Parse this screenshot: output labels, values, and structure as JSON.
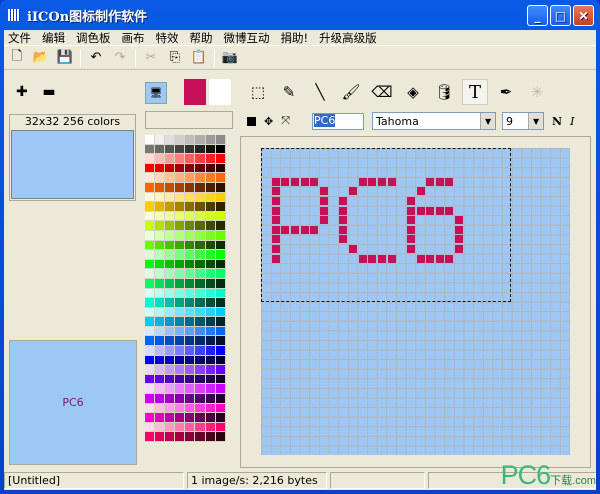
{
  "window": {
    "title": "iICOn图标制作软件"
  },
  "menu": [
    "文件",
    "编辑",
    "调色板",
    "画布",
    "特效",
    "帮助",
    "微博互动",
    "捐助!",
    "升级高级版"
  ],
  "toolbar": [
    {
      "icon": "new-file-icon",
      "glyph": "🗋"
    },
    {
      "icon": "open-folder-icon",
      "glyph": "📂"
    },
    {
      "icon": "save-icon",
      "glyph": "💾"
    },
    {
      "icon": "undo-icon",
      "glyph": "↶"
    },
    {
      "icon": "redo-icon",
      "glyph": "↷"
    },
    {
      "icon": "cut-icon",
      "glyph": "✂"
    },
    {
      "icon": "copy-icon",
      "glyph": "⎘"
    },
    {
      "icon": "paste-icon",
      "glyph": "📋"
    },
    {
      "icon": "camera-icon",
      "glyph": "📷"
    }
  ],
  "left": {
    "size_label": "32x32 256 colors",
    "preview_text": "PC6"
  },
  "colors": {
    "foreground": "#c8105a",
    "background": "#ffffff",
    "canvas_bg": "#9dc8f5"
  },
  "palette_hues": [
    "#ff0000",
    "#ff6600",
    "#ffcc00",
    "#ccff00",
    "#66ff00",
    "#00ff00",
    "#00ff66",
    "#00ffcc",
    "#00ccff",
    "#0066ff",
    "#0000ff",
    "#6600ff",
    "#cc00ff",
    "#ff00cc",
    "#ff0066"
  ],
  "tools": [
    {
      "name": "select-tool",
      "glyph": "⬚"
    },
    {
      "name": "pencil-tool",
      "glyph": "✎"
    },
    {
      "name": "line-tool",
      "glyph": "╲"
    },
    {
      "name": "brush-tool",
      "glyph": "🖌"
    },
    {
      "name": "eraser-tool",
      "glyph": "⌫"
    },
    {
      "name": "shape-tool",
      "glyph": "◈"
    },
    {
      "name": "fill-tool",
      "glyph": "🛢"
    },
    {
      "name": "text-tool",
      "glyph": "T"
    },
    {
      "name": "eyedropper-tool",
      "glyph": "✒"
    },
    {
      "name": "magic-wand-tool",
      "glyph": "✳"
    }
  ],
  "textbar": {
    "text_value": "PC6",
    "font": "Tahoma",
    "size": "9",
    "bold": "N",
    "italic": "I"
  },
  "canvas": {
    "cols": 32,
    "rows": 32,
    "pixels": [
      [
        1,
        3
      ],
      [
        2,
        3
      ],
      [
        3,
        3
      ],
      [
        4,
        3
      ],
      [
        5,
        3
      ],
      [
        6,
        4
      ],
      [
        6,
        5
      ],
      [
        6,
        6
      ],
      [
        6,
        7
      ],
      [
        1,
        4
      ],
      [
        1,
        5
      ],
      [
        1,
        6
      ],
      [
        1,
        7
      ],
      [
        1,
        8
      ],
      [
        1,
        9
      ],
      [
        1,
        10
      ],
      [
        1,
        11
      ],
      [
        2,
        8
      ],
      [
        3,
        8
      ],
      [
        4,
        8
      ],
      [
        5,
        8
      ],
      [
        10,
        3
      ],
      [
        11,
        3
      ],
      [
        12,
        3
      ],
      [
        13,
        3
      ],
      [
        9,
        4
      ],
      [
        8,
        5
      ],
      [
        8,
        6
      ],
      [
        8,
        7
      ],
      [
        8,
        8
      ],
      [
        8,
        9
      ],
      [
        9,
        10
      ],
      [
        10,
        11
      ],
      [
        11,
        11
      ],
      [
        12,
        11
      ],
      [
        13,
        11
      ],
      [
        17,
        3
      ],
      [
        18,
        3
      ],
      [
        19,
        3
      ],
      [
        16,
        4
      ],
      [
        15,
        5
      ],
      [
        15,
        6
      ],
      [
        15,
        7
      ],
      [
        15,
        8
      ],
      [
        15,
        9
      ],
      [
        15,
        10
      ],
      [
        16,
        6
      ],
      [
        17,
        6
      ],
      [
        18,
        6
      ],
      [
        19,
        6
      ],
      [
        20,
        7
      ],
      [
        20,
        8
      ],
      [
        20,
        9
      ],
      [
        20,
        10
      ],
      [
        16,
        11
      ],
      [
        17,
        11
      ],
      [
        18,
        11
      ],
      [
        19,
        11
      ]
    ]
  },
  "status": {
    "file": "[Untitled]",
    "info": "1 image/s: 2,216 bytes",
    "logo": "PC6",
    "logo_sub": "下载.com"
  }
}
